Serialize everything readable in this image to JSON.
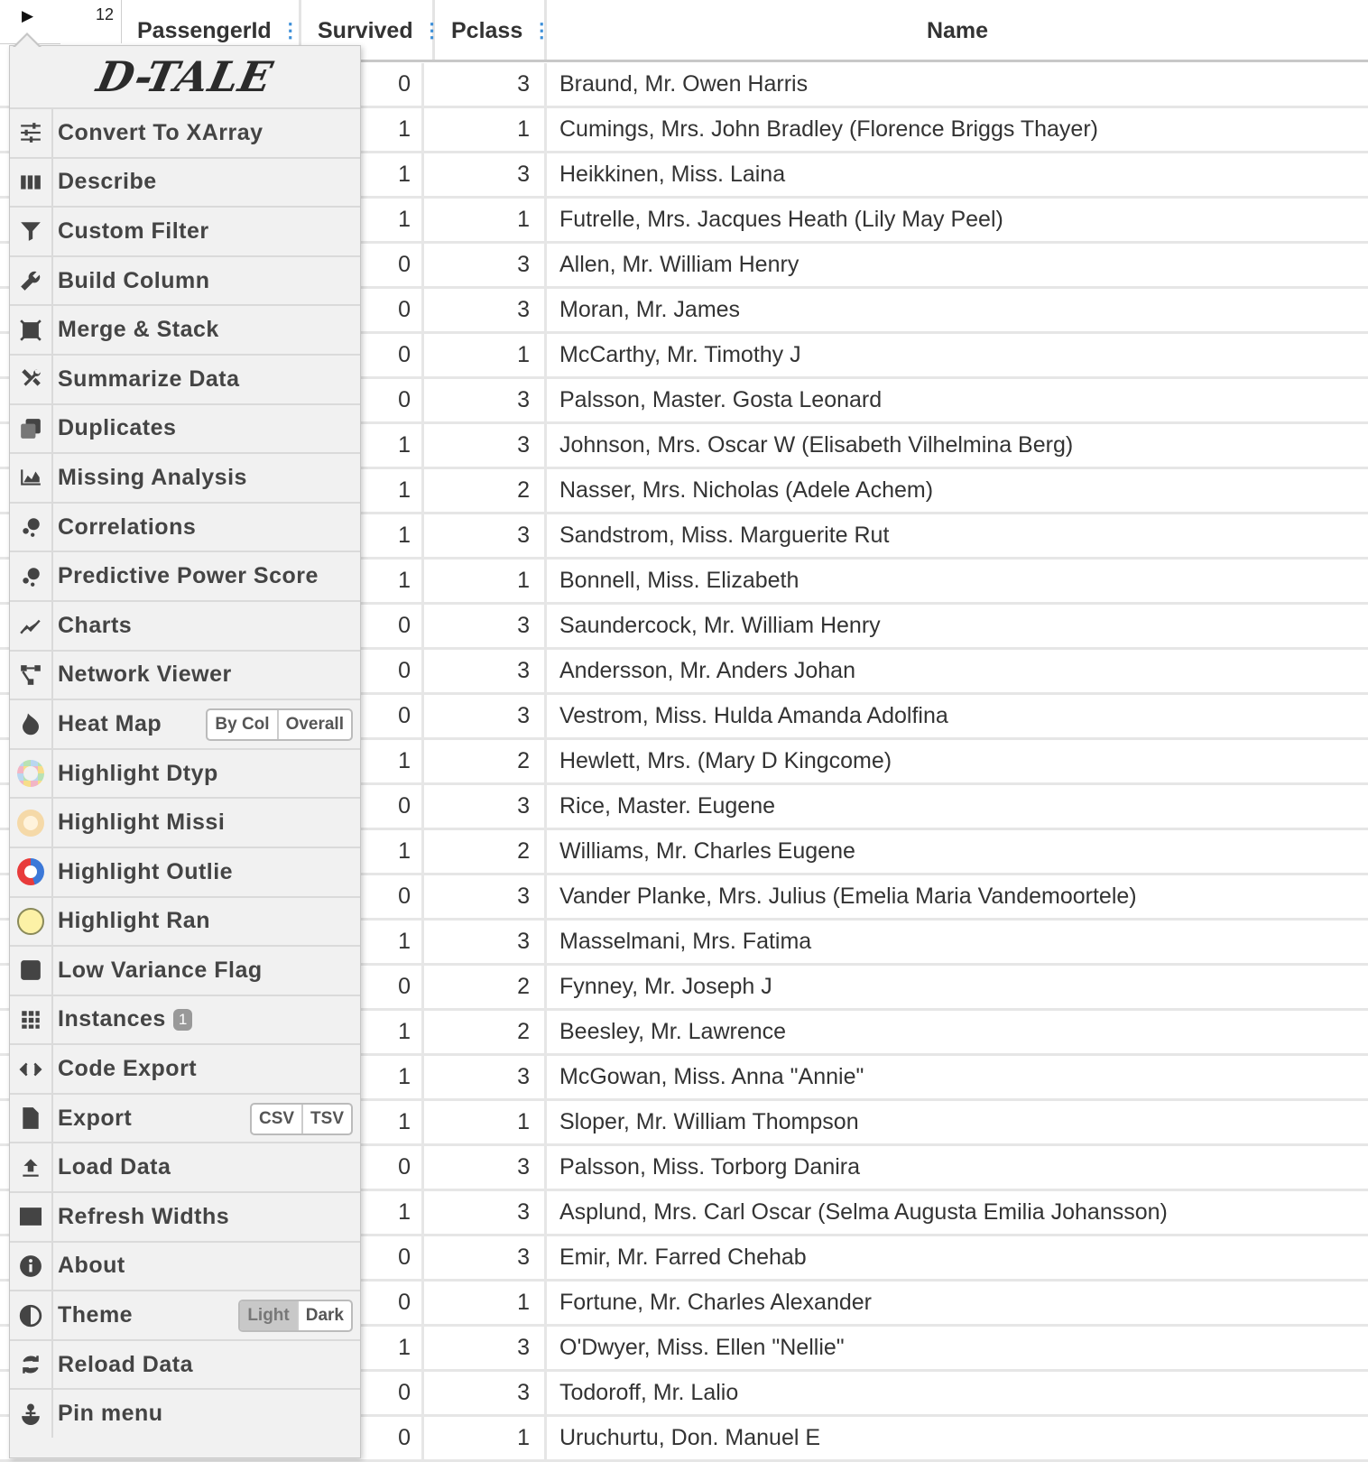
{
  "header": {
    "row_count": "12",
    "columns": {
      "passengerid": "PassengerId",
      "survived": "Survived",
      "pclass": "Pclass",
      "name": "Name"
    }
  },
  "rows": [
    {
      "survived": "0",
      "pclass": "3",
      "name": "Braund, Mr. Owen Harris"
    },
    {
      "survived": "1",
      "pclass": "1",
      "name": "Cumings, Mrs. John Bradley (Florence Briggs Thayer)"
    },
    {
      "survived": "1",
      "pclass": "3",
      "name": "Heikkinen, Miss. Laina"
    },
    {
      "survived": "1",
      "pclass": "1",
      "name": "Futrelle, Mrs. Jacques Heath (Lily May Peel)"
    },
    {
      "survived": "0",
      "pclass": "3",
      "name": "Allen, Mr. William Henry"
    },
    {
      "survived": "0",
      "pclass": "3",
      "name": "Moran, Mr. James"
    },
    {
      "survived": "0",
      "pclass": "1",
      "name": "McCarthy, Mr. Timothy J"
    },
    {
      "survived": "0",
      "pclass": "3",
      "name": "Palsson, Master. Gosta Leonard"
    },
    {
      "survived": "1",
      "pclass": "3",
      "name": "Johnson, Mrs. Oscar W (Elisabeth Vilhelmina Berg)"
    },
    {
      "survived": "1",
      "pclass": "2",
      "name": "Nasser, Mrs. Nicholas (Adele Achem)"
    },
    {
      "survived": "1",
      "pclass": "3",
      "name": "Sandstrom, Miss. Marguerite Rut"
    },
    {
      "survived": "1",
      "pclass": "1",
      "name": "Bonnell, Miss. Elizabeth"
    },
    {
      "survived": "0",
      "pclass": "3",
      "name": "Saundercock, Mr. William Henry"
    },
    {
      "survived": "0",
      "pclass": "3",
      "name": "Andersson, Mr. Anders Johan"
    },
    {
      "survived": "0",
      "pclass": "3",
      "name": "Vestrom, Miss. Hulda Amanda Adolfina"
    },
    {
      "survived": "1",
      "pclass": "2",
      "name": "Hewlett, Mrs. (Mary D Kingcome)"
    },
    {
      "survived": "0",
      "pclass": "3",
      "name": "Rice, Master. Eugene"
    },
    {
      "survived": "1",
      "pclass": "2",
      "name": "Williams, Mr. Charles Eugene"
    },
    {
      "survived": "0",
      "pclass": "3",
      "name": "Vander Planke, Mrs. Julius (Emelia Maria Vandemoortele)"
    },
    {
      "survived": "1",
      "pclass": "3",
      "name": "Masselmani, Mrs. Fatima"
    },
    {
      "survived": "0",
      "pclass": "2",
      "name": "Fynney, Mr. Joseph J"
    },
    {
      "survived": "1",
      "pclass": "2",
      "name": "Beesley, Mr. Lawrence"
    },
    {
      "survived": "1",
      "pclass": "3",
      "name": "McGowan, Miss. Anna \"Annie\""
    },
    {
      "survived": "1",
      "pclass": "1",
      "name": "Sloper, Mr. William Thompson"
    },
    {
      "survived": "0",
      "pclass": "3",
      "name": "Palsson, Miss. Torborg Danira"
    },
    {
      "survived": "1",
      "pclass": "3",
      "name": "Asplund, Mrs. Carl Oscar (Selma Augusta Emilia Johansson)"
    },
    {
      "survived": "0",
      "pclass": "3",
      "name": "Emir, Mr. Farred Chehab"
    },
    {
      "survived": "0",
      "pclass": "1",
      "name": "Fortune, Mr. Charles Alexander"
    },
    {
      "survived": "1",
      "pclass": "3",
      "name": "O'Dwyer, Miss. Ellen \"Nellie\""
    },
    {
      "survived": "0",
      "pclass": "3",
      "name": "Todoroff, Mr. Lalio"
    },
    {
      "survived": "0",
      "pclass": "1",
      "name": "Uruchurtu, Don. Manuel E"
    }
  ],
  "menu": {
    "logo": "D-TALE",
    "items": [
      {
        "label": "Convert To XArray",
        "icon": "sliders-icon"
      },
      {
        "label": "Describe",
        "icon": "columns-icon"
      },
      {
        "label": "Custom Filter",
        "icon": "filter-icon"
      },
      {
        "label": "Build Column",
        "icon": "wrench-icon"
      },
      {
        "label": "Merge & Stack",
        "icon": "merge-icon"
      },
      {
        "label": "Summarize Data",
        "icon": "tools-icon"
      },
      {
        "label": "Duplicates",
        "icon": "copy-icon"
      },
      {
        "label": "Missing Analysis",
        "icon": "area-chart-icon"
      },
      {
        "label": "Correlations",
        "icon": "bubbles-icon"
      },
      {
        "label": "Predictive Power Score",
        "icon": "bubbles-icon"
      },
      {
        "label": "Charts",
        "icon": "line-chart-icon"
      },
      {
        "label": "Network Viewer",
        "icon": "network-icon"
      },
      {
        "label": "Heat Map",
        "icon": "fire-icon",
        "buttons": [
          "By Col",
          "Overall"
        ]
      },
      {
        "label": "Highlight Dtyp",
        "icon": "dtype-ring-icon"
      },
      {
        "label": "Highlight Missi",
        "icon": "missing-ring-icon"
      },
      {
        "label": "Highlight Outlie",
        "icon": "outlier-ring-icon"
      },
      {
        "label": "Highlight Ran",
        "icon": "range-circle-icon"
      },
      {
        "label": "Low Variance Flag",
        "icon": "checkbox-icon"
      },
      {
        "label": "Instances",
        "icon": "grid-icon",
        "badge": "1"
      },
      {
        "label": "Code Export",
        "icon": "code-icon"
      },
      {
        "label": "Export",
        "icon": "file-icon",
        "buttons": [
          "CSV",
          "TSV"
        ]
      },
      {
        "label": "Load Data",
        "icon": "upload-icon"
      },
      {
        "label": "Refresh Widths",
        "icon": "table-columns-icon"
      },
      {
        "label": "About",
        "icon": "info-icon"
      },
      {
        "label": "Theme",
        "icon": "contrast-icon",
        "buttons": [
          "Light",
          "Dark"
        ],
        "active": "Light"
      },
      {
        "label": "Reload Data",
        "icon": "refresh-icon"
      },
      {
        "label": "Pin menu",
        "icon": "anchor-icon"
      }
    ]
  },
  "colors": {
    "header_dots": "#3d8fd8",
    "menu_bg": "#f1f1f1"
  }
}
